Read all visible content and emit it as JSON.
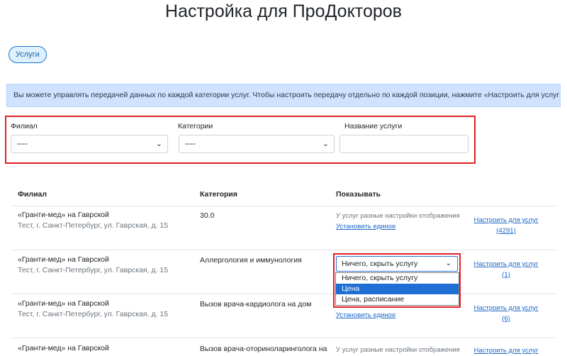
{
  "page_title": "Настройка для ПроДокторов",
  "tab_label": "Услуги",
  "info_text": "Вы можете управлять передачей данных по каждой категории услуг. Чтобы настроить передачу отдельно по каждой позиции, нажмите «Настроить для услуг»",
  "filters": {
    "branch_label": "Филиал",
    "branch_value": "----",
    "category_label": "Категории",
    "category_value": "----",
    "service_label": "Название услуги",
    "service_value": ""
  },
  "table": {
    "headers": [
      "Филиал",
      "Категория",
      "Показывать"
    ],
    "rows": [
      {
        "branch": "«Гранти-мед» на Гаврской",
        "address": "Тест, г. Санкт-Петербург, ул. Гаврская, д. 15",
        "category": "30.0",
        "show_note": "У услуг разные настройки отображения",
        "show_link": "Установить единое",
        "config_link": "Настроить для услуг",
        "config_count": "(4291)"
      },
      {
        "branch": "«Гранти-мед» на Гаврской",
        "address": "Тест, г. Санкт-Петербург, ул. Гаврская, д. 15",
        "category": "Аллергология и иммунология",
        "show_select": "Ничего, скрыть услугу",
        "config_link": "Настроить для услуг",
        "config_count": "(1)"
      },
      {
        "branch": "«Гранти-мед» на Гаврской",
        "address": "Тест, г. Санкт-Петербург, ул. Гаврская, д. 15",
        "category": "Вызов врача-кардиолога на дом",
        "show_link": "Установить единое",
        "config_link": "Настроить для услуг",
        "config_count": "(6)"
      },
      {
        "branch": "«Гранти-мед» на Гаврской",
        "category": "Вызов врача-оториноларинголога на",
        "show_note": "У услуг разные настройки отображения",
        "config_link": "Настроить для услуг"
      }
    ]
  },
  "dropdown": {
    "options": [
      "Ничего, скрыть услугу",
      "Цена",
      "Цена, расписание"
    ],
    "highlighted": "Цена"
  },
  "colors": {
    "accent": "#1a66c9",
    "highlight_border": "#e31e24",
    "info_bg": "#cfe2ff",
    "option_selected": "#1e6ed3"
  }
}
